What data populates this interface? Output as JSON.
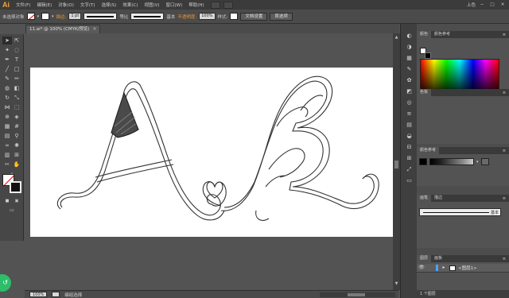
{
  "menubar": {
    "logo": "Ai",
    "items": [
      "文件(F)",
      "编辑(E)",
      "对象(O)",
      "文字(T)",
      "选择(S)",
      "效果(C)",
      "视图(V)",
      "窗口(W)",
      "帮助(H)"
    ],
    "right_label": "上色",
    "window_controls": [
      "−",
      "□",
      "✕"
    ]
  },
  "controlbar": {
    "object_label": "未选择对象",
    "stroke_label": "描边:",
    "stroke_value": "1 pt",
    "profile_label": "等比",
    "brush_label": "基本",
    "opacity_label": "不透明度:",
    "opacity_value": "100%",
    "style_label": "样式:",
    "doc_setup": "文档设置",
    "preferences": "首选项"
  },
  "document": {
    "tab_title": "11.ai* @ 100% (CMYK/预览)",
    "close": "✕"
  },
  "status": {
    "zoom": "100%",
    "tool": "编组选择"
  },
  "panels": {
    "color_tabs": [
      "颜色",
      "颜色参考"
    ],
    "guide_label": "色板",
    "guide_tabs": [
      "颜色参考"
    ],
    "stroke_tabs": [
      "画笔",
      "描边"
    ],
    "brush_label": "基本",
    "layers_tabs": [
      "图层",
      "画板"
    ],
    "layer_name": "<图层1>",
    "layer_count": "1 个图层",
    "menu_icon": "≡"
  },
  "badge": "↺",
  "colors": {
    "accent": "#e8963a",
    "canvas_bg": "#535353",
    "artboard": "#ffffff",
    "layer_color": "#4aa3ff"
  }
}
